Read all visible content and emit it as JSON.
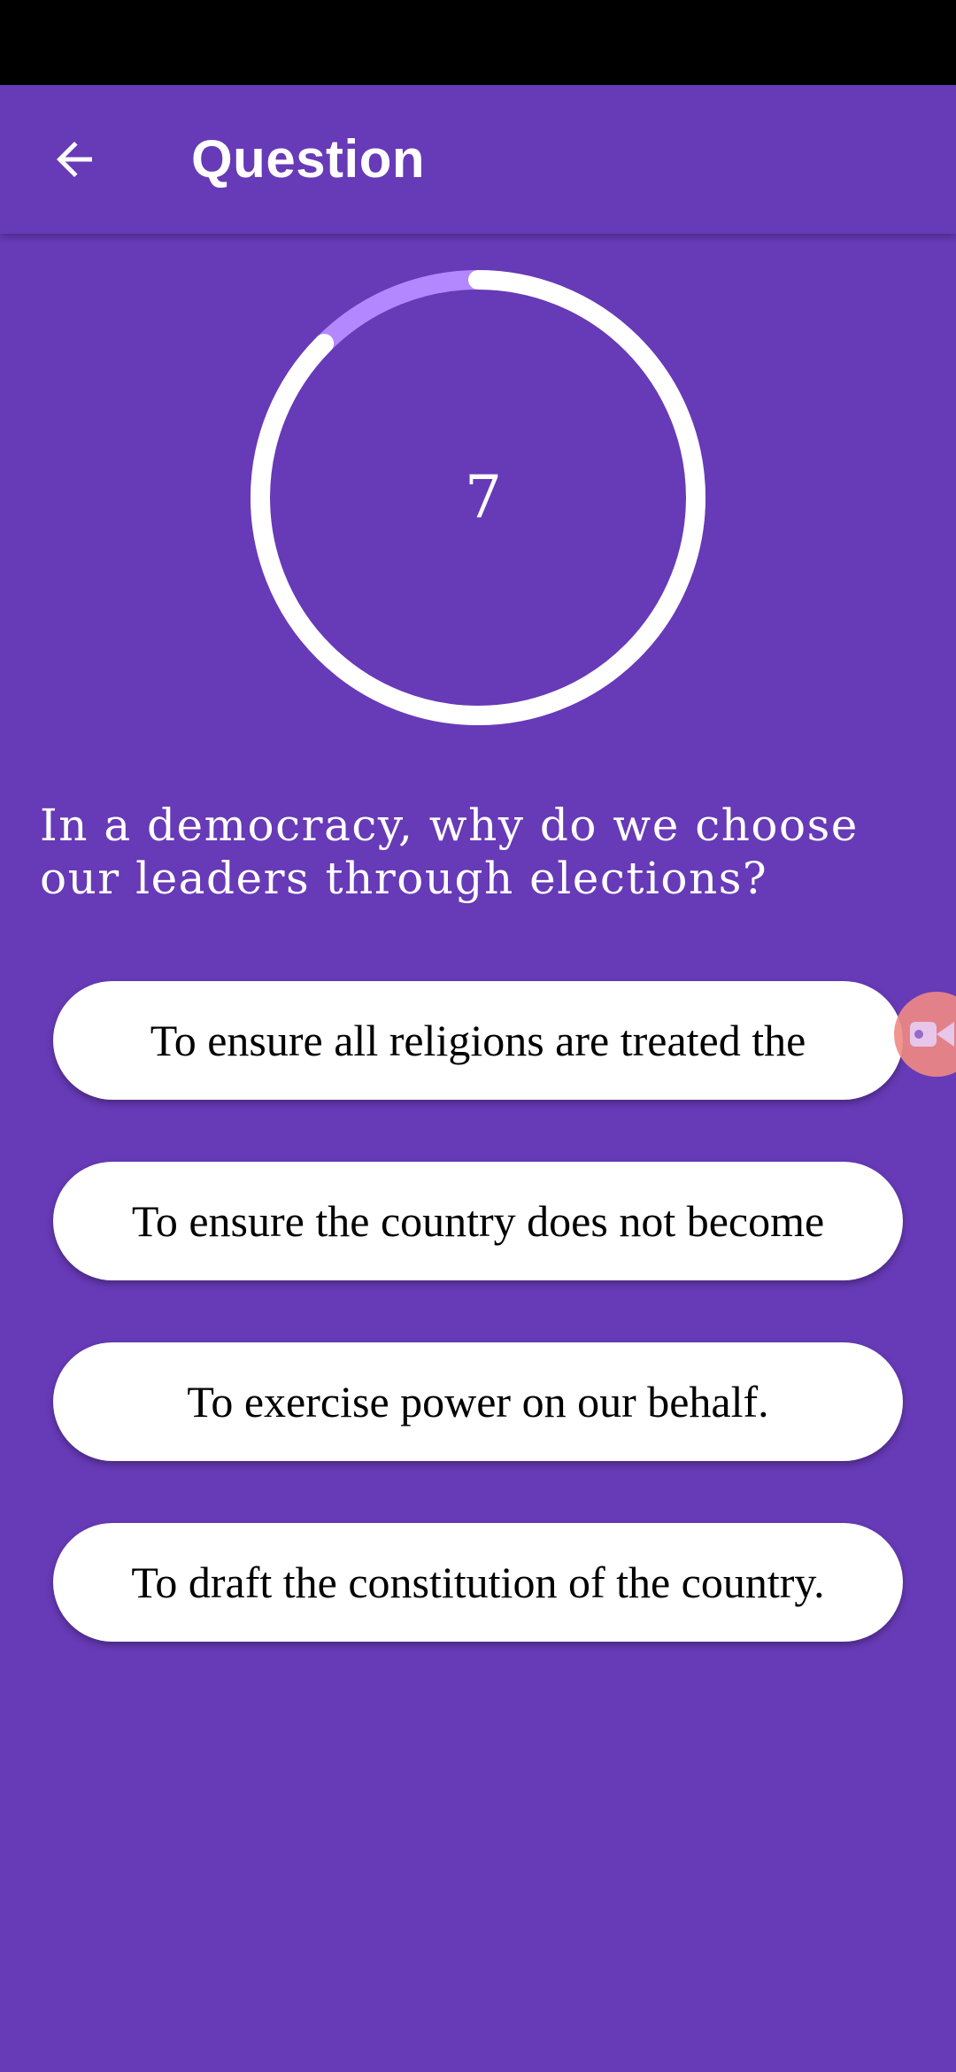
{
  "app_bar": {
    "title": "Question",
    "back_icon": "arrow-left-icon"
  },
  "timer": {
    "value": "7",
    "progress_remaining_fraction": 0.875,
    "track_color": "#b388ff",
    "progress_color": "#ffffff"
  },
  "question": {
    "text": "In a democracy, why do we choose our leaders through elections?"
  },
  "options": [
    {
      "label": "To ensure all religions are treated the"
    },
    {
      "label": "To ensure the country does not become"
    },
    {
      "label": "To exercise power on our behalf."
    },
    {
      "label": "To draft the constitution of the country."
    }
  ],
  "floating_badge": {
    "icon": "video-camera-icon",
    "color": "#f08a84"
  },
  "colors": {
    "background": "#673ab7",
    "status_bar": "#000000",
    "option_background": "#ffffff"
  }
}
